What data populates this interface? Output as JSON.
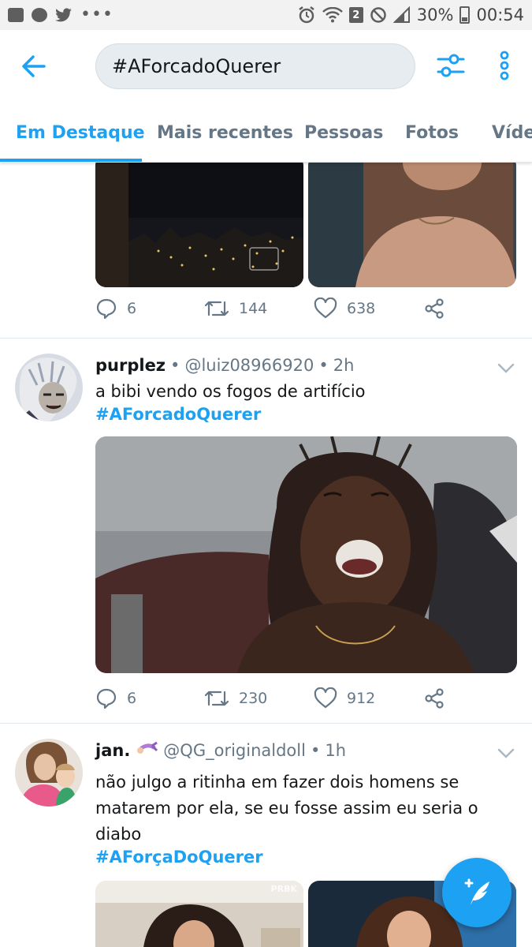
{
  "status_bar": {
    "left_icons": [
      "gallery-icon",
      "whatsapp-icon",
      "twitter-icon"
    ],
    "dots": "•••",
    "sim": "2",
    "battery": "30%",
    "time": "00:54"
  },
  "header": {
    "search_value": "#AForcadoQuerer"
  },
  "tabs": [
    "Em Destaque",
    "Mais recentes",
    "Pessoas",
    "Fotos",
    "Vídeos"
  ],
  "feed": {
    "partial_tweet": {
      "replies": "6",
      "retweets": "144",
      "likes": "638"
    },
    "tweets": [
      {
        "name": "purplez",
        "handle": "@luiz08966920",
        "time": "2h",
        "text": "a bibi vendo os fogos de artifício",
        "hashtag": "#AForcadoQuerer",
        "replies": "6",
        "retweets": "230",
        "likes": "912"
      },
      {
        "name": "jan.",
        "handle": "@QG_originaldoll",
        "time": "1h",
        "text": "não julgo a ritinha em fazer dois homens se matarem por ela, se eu fosse assim eu seria o diabo",
        "hashtag": "#AForçaDoQuerer",
        "watermark": "PRBK"
      }
    ]
  },
  "colors": {
    "accent": "#1da1f2",
    "muted": "#657786",
    "text": "#14171a"
  }
}
